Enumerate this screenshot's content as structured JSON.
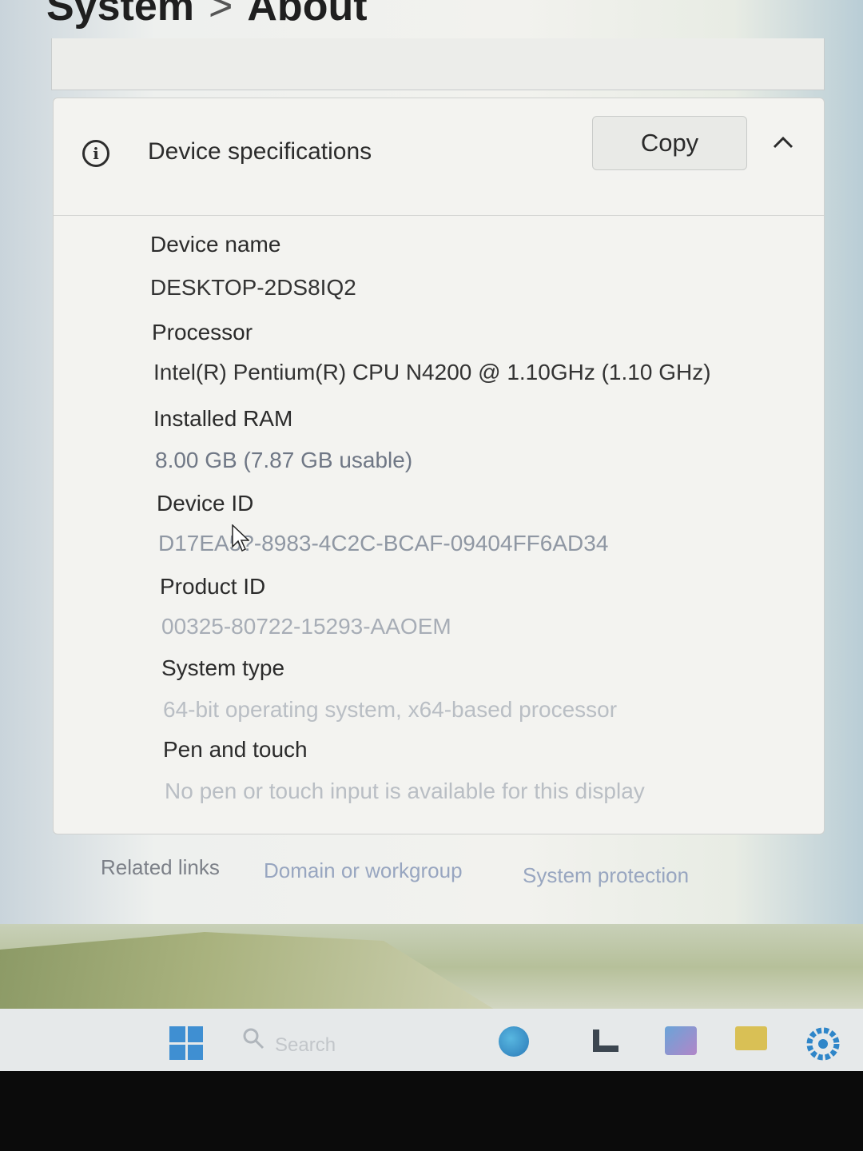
{
  "breadcrumb": {
    "parent": "System",
    "separator": ">",
    "current": "About"
  },
  "device_specs": {
    "title": "Device specifications",
    "copy_label": "Copy",
    "items": [
      {
        "label": "Device name",
        "value": "DESKTOP-2DS8IQ2"
      },
      {
        "label": "Processor",
        "value": "Intel(R) Pentium(R) CPU N4200 @ 1.10GHz (1.10 GHz)"
      },
      {
        "label": "Installed RAM",
        "value": "8.00 GB (7.87 GB usable)"
      },
      {
        "label": "Device ID",
        "value": "D17EA5?-8983-4C2C-BCAF-09404FF6AD34"
      },
      {
        "label": "Product ID",
        "value": "00325-80722-15293-AAOEM"
      },
      {
        "label": "System type",
        "value": "64-bit operating system, x64-based processor"
      },
      {
        "label": "Pen and touch",
        "value": "No pen or touch input is available for this display"
      }
    ]
  },
  "related_links": {
    "label": "Related links",
    "links": [
      "Domain or workgroup",
      "System protection"
    ]
  },
  "taskbar": {
    "search_label": "Search",
    "icons": [
      "start-icon",
      "search-icon",
      "edge-icon",
      "file-explorer-icon",
      "store-icon",
      "folder-icon",
      "settings-icon"
    ]
  },
  "colors": {
    "accent": "#3f8fd2",
    "link": "#98a6c0"
  }
}
